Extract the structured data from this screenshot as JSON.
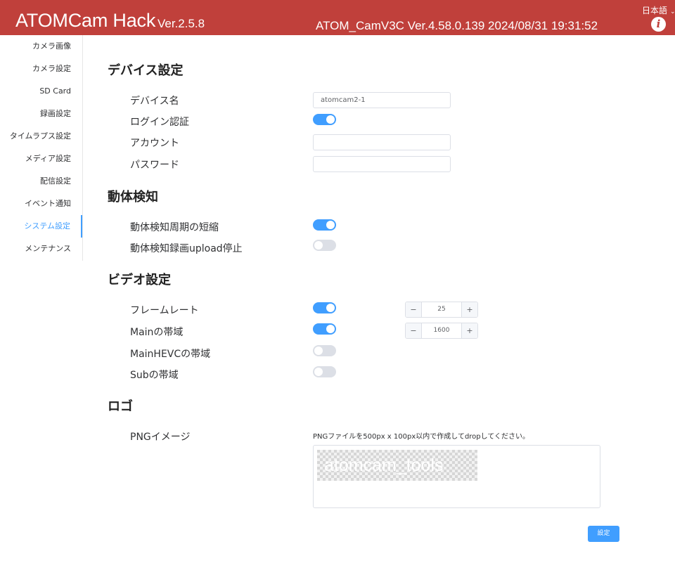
{
  "header": {
    "app_title": "ATOMCam Hack",
    "app_version": "Ver.2.5.8",
    "camera_info": "ATOM_CamV3C Ver.4.58.0.139   2024/08/31 19:31:52",
    "language": "日本語",
    "info_icon": "i"
  },
  "sidebar": {
    "items": [
      {
        "label": "カメラ画像"
      },
      {
        "label": "カメラ設定"
      },
      {
        "label": "SD Card"
      },
      {
        "label": "録画設定"
      },
      {
        "label": "タイムラプス設定"
      },
      {
        "label": "メディア設定"
      },
      {
        "label": "配信設定"
      },
      {
        "label": "イベント通知"
      },
      {
        "label": "システム設定",
        "active": true
      },
      {
        "label": "メンテナンス"
      }
    ]
  },
  "device": {
    "title": "デバイス設定",
    "device_name_label": "デバイス名",
    "device_name_value": "atomcam2-1",
    "login_auth_label": "ログイン認証",
    "login_auth_on": true,
    "account_label": "アカウント",
    "account_value": "",
    "password_label": "パスワード",
    "password_value": ""
  },
  "motion": {
    "title": "動体検知",
    "shorten_label": "動体検知周期の短縮",
    "shorten_on": true,
    "stop_upload_label": "動体検知録画upload停止",
    "stop_upload_on": false
  },
  "video": {
    "title": "ビデオ設定",
    "framerate_label": "フレームレート",
    "framerate_on": true,
    "framerate_value": "25",
    "main_bw_label": "Mainの帯域",
    "main_bw_on": true,
    "main_bw_value": "1600",
    "mainhevc_bw_label": "MainHEVCの帯域",
    "mainhevc_bw_on": false,
    "sub_bw_label": "Subの帯域",
    "sub_bw_on": false,
    "minus": "−",
    "plus": "+"
  },
  "logo": {
    "title": "ロゴ",
    "png_label": "PNGイメージ",
    "hint": "PNGファイルを500px x 100px以内で作成してdropしてください。",
    "preview_text": "atomcam_tools"
  },
  "submit_label": "設定",
  "colors": {
    "header_bg": "#c0403b",
    "accent": "#409eff",
    "switch_off": "#dcdfe6"
  }
}
